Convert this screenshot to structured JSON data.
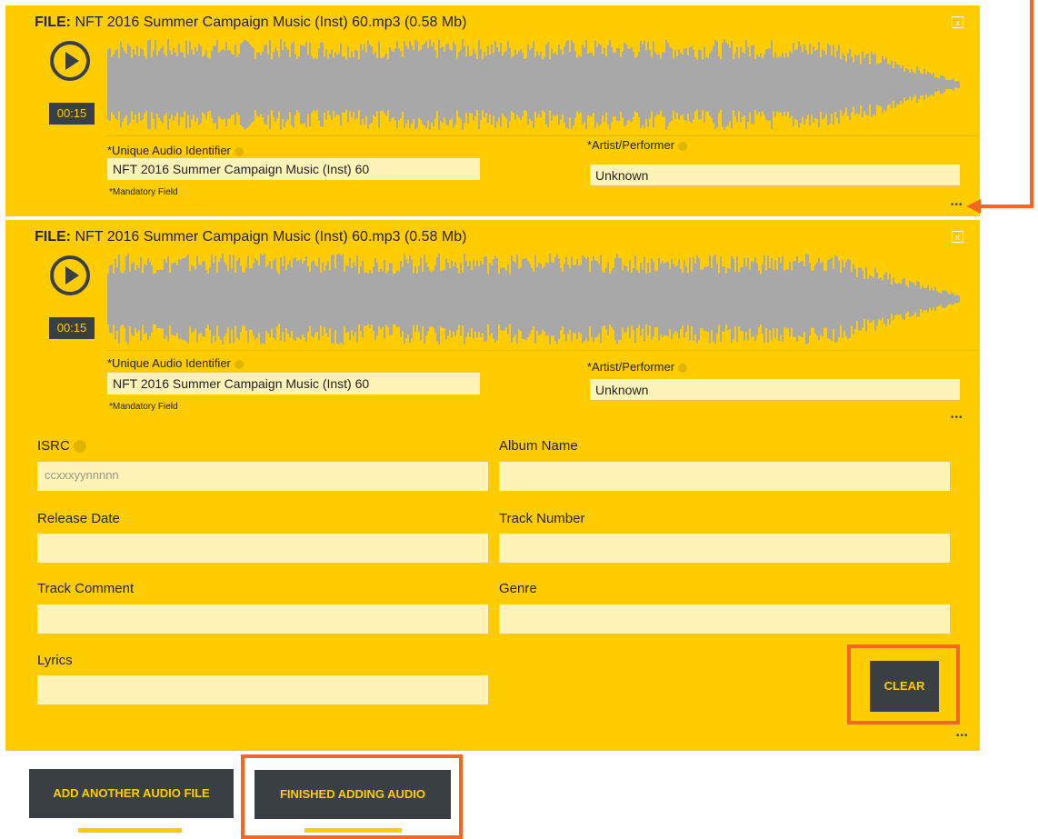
{
  "files": [
    {
      "file_label": "FILE:",
      "file_name": "NFT 2016 Summer Campaign Music (Inst) 60.mp3 (0.58 Mb)",
      "close_label": "x",
      "timecode": "00:15",
      "uid_label": "*Unique Audio Identifier",
      "uid_value": "NFT 2016 Summer Campaign Music (Inst) 60",
      "artist_label": "*Artist/Performer",
      "artist_value": "Unknown",
      "mandatory_note": "*Mandatory Field",
      "more_label": "•••"
    },
    {
      "file_label": "FILE:",
      "file_name": "NFT 2016 Summer Campaign Music (Inst) 60.mp3 (0.58 Mb)",
      "close_label": "x",
      "timecode": "00:15",
      "uid_label": "*Unique Audio Identifier",
      "uid_value": "NFT 2016 Summer Campaign Music (Inst) 60",
      "artist_label": "*Artist/Performer",
      "artist_value": "Unknown",
      "mandatory_note": "*Mandatory Field",
      "more_label": "•••"
    }
  ],
  "metadata": {
    "isrc_label": "ISRC",
    "isrc_placeholder": "ccxxxyynnnnn",
    "album_label": "Album Name",
    "release_label": "Release Date",
    "track_number_label": "Track Number",
    "track_comment_label": "Track Comment",
    "genre_label": "Genre",
    "lyrics_label": "Lyrics",
    "clear_label": "CLEAR",
    "more_label": "•••"
  },
  "actions": {
    "add_another_label": "ADD ANOTHER AUDIO FILE",
    "finished_label": "FINISHED ADDING AUDIO"
  },
  "colors": {
    "panel": "#ffcc00",
    "dark": "#3a3f44",
    "input": "#fff3b8",
    "highlight": "#f26722",
    "waveform": "#a8a8a8"
  }
}
